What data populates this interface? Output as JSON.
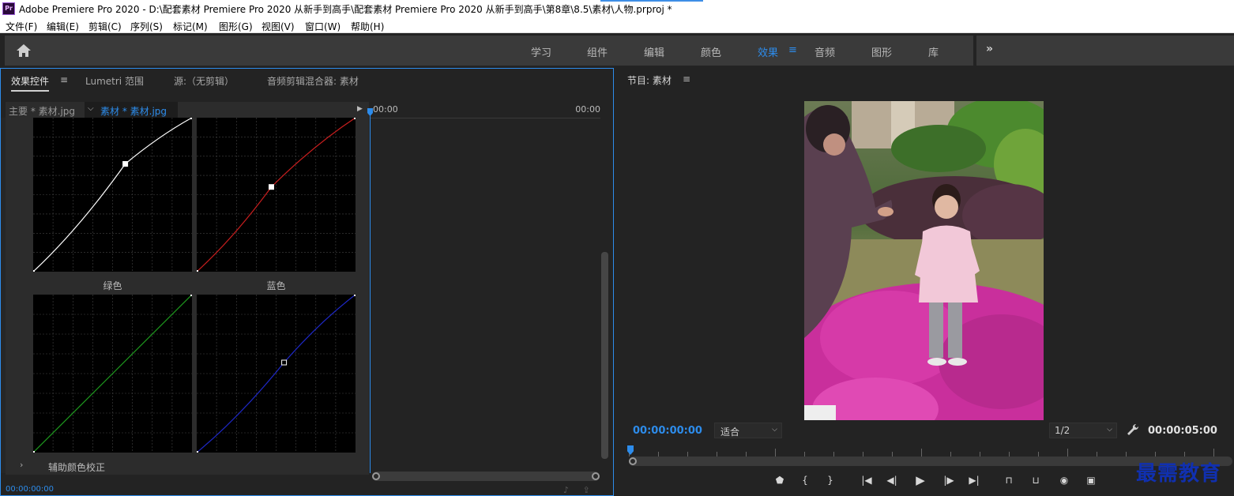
{
  "app": {
    "title": "Adobe Premiere Pro 2020 - D:\\配套素材 Premiere Pro 2020 从新手到高手\\配套素材 Premiere Pro 2020 从新手到高手\\第8章\\8.5\\素材\\人物.prproj *",
    "logo_text": "Pr"
  },
  "menu": [
    "文件(F)",
    "编辑(E)",
    "剪辑(C)",
    "序列(S)",
    "标记(M)",
    "图形(G)",
    "视图(V)",
    "窗口(W)",
    "帮助(H)"
  ],
  "workspaces": {
    "tabs": [
      "学习",
      "组件",
      "编辑",
      "颜色",
      "效果",
      "音频",
      "图形",
      "库"
    ],
    "active": "效果",
    "active_menu_icon": "≡",
    "overflow": "»"
  },
  "effect_controls": {
    "tabs": [
      "效果控件",
      "Lumetri 范围",
      "源:（无剪辑）",
      "音频剪辑混合器: 素材"
    ],
    "tab_menu_icon": "≡",
    "master_clip": "主要 * 素材.jpg",
    "sequence_clip": "素材 * 素材.jpg",
    "timeline_start": "00:00",
    "timeline_end": "00:00",
    "curve_labels": {
      "green": "绿色",
      "blue": "蓝色"
    },
    "aux_section": "辅助颜色校正",
    "timecode": "00:00:00:00",
    "curve_colors": {
      "luma": "#ffffff",
      "red": "#c81e1e",
      "green": "#1e9a1e",
      "blue": "#1e28c8"
    },
    "curve_points": {
      "luma": [
        [
          0,
          0
        ],
        [
          0.58,
          0.7
        ],
        [
          1,
          1
        ]
      ],
      "red": [
        [
          0,
          0
        ],
        [
          0.47,
          0.55
        ],
        [
          1,
          1
        ]
      ],
      "green": [
        [
          0,
          0
        ],
        [
          1,
          1
        ]
      ],
      "blue": [
        [
          0,
          0
        ],
        [
          0.55,
          0.57
        ],
        [
          1,
          1
        ]
      ]
    }
  },
  "program_monitor": {
    "title": "节目: 素材",
    "menu_icon": "≡",
    "timecode_current": "00:00:00:00",
    "fit": "适合",
    "resolution": "1/2",
    "timecode_duration": "00:00:05:00",
    "transport": [
      "mark-in-marker-icon",
      "mark-in-icon",
      "mark-out-icon",
      "go-to-in-icon",
      "step-back-icon",
      "play-icon",
      "step-forward-icon",
      "go-to-out-icon",
      "lift-icon",
      "extract-icon",
      "export-frame-icon",
      "compare-icon"
    ]
  },
  "watermark": "最需教育"
}
